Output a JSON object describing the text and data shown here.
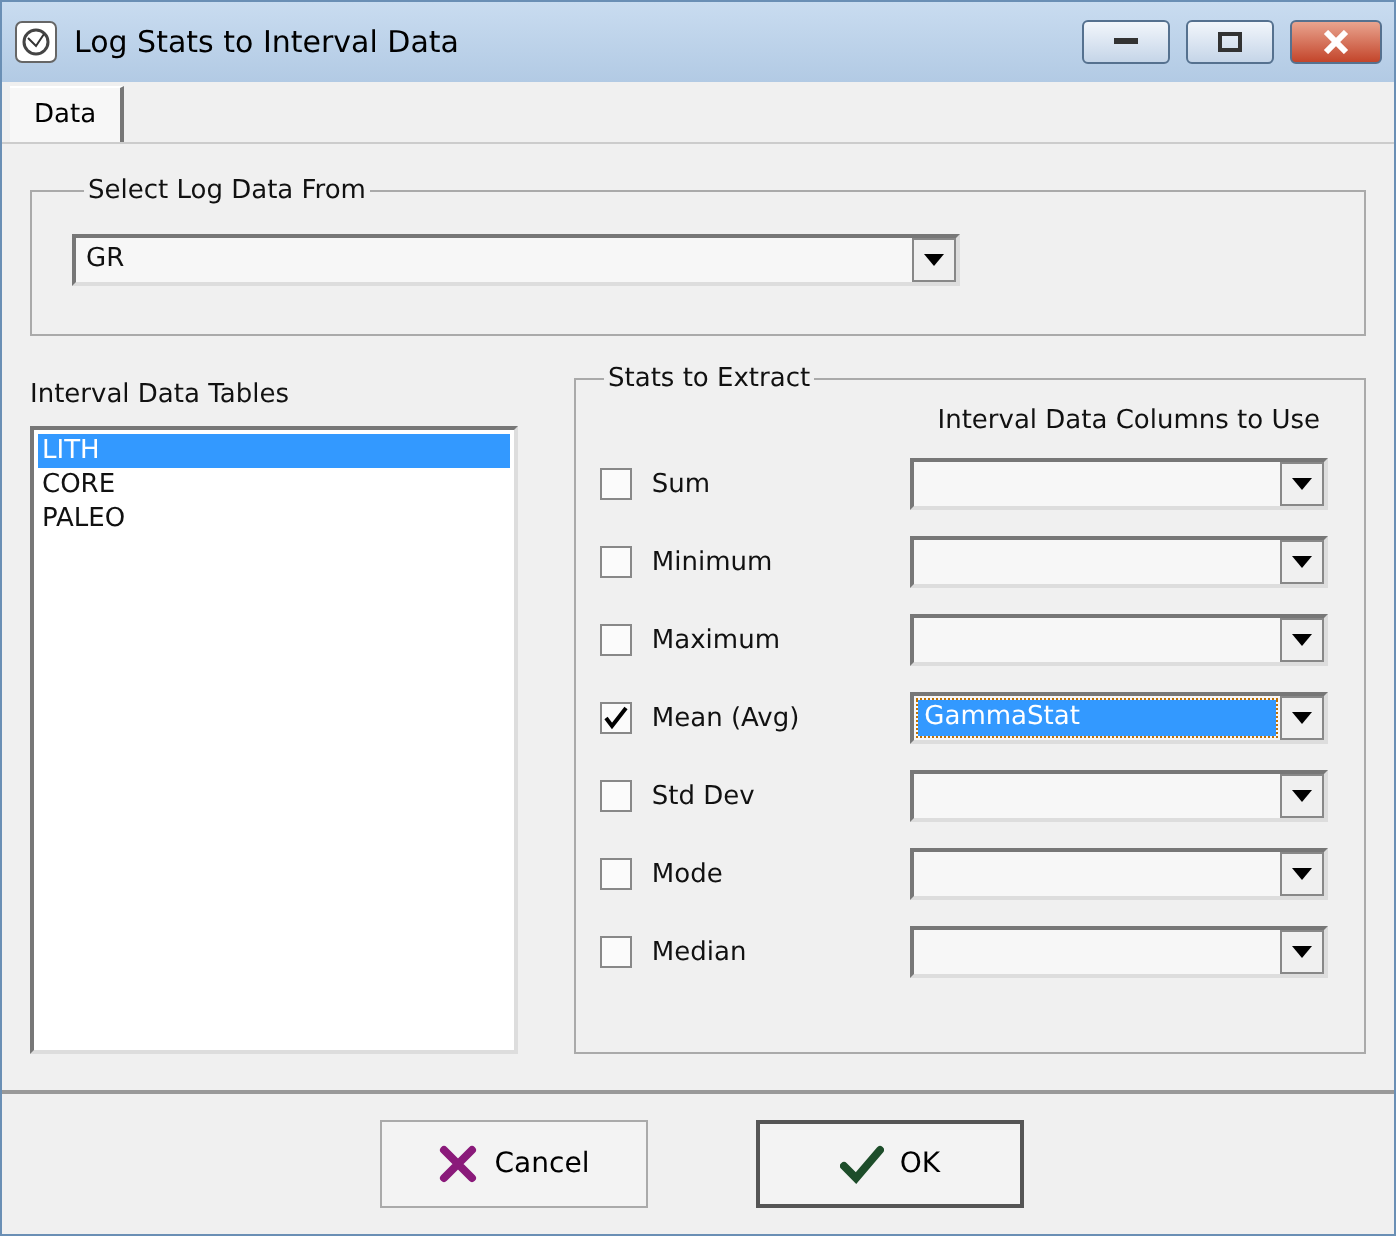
{
  "window": {
    "title": "Log Stats to Interval Data"
  },
  "tabs": [
    {
      "label": "Data",
      "selected": true
    }
  ],
  "log_source": {
    "label": "Select Log Data From",
    "value": "GR"
  },
  "interval_tables": {
    "label": "Interval Data Tables",
    "items": [
      {
        "label": "LITH",
        "selected": true
      },
      {
        "label": "CORE",
        "selected": false
      },
      {
        "label": "PALEO",
        "selected": false
      }
    ]
  },
  "stats": {
    "label": "Stats to Extract",
    "column_header": "Interval Data Columns to Use",
    "rows": [
      {
        "label": "Sum",
        "checked": false,
        "column": "",
        "selected": false
      },
      {
        "label": "Minimum",
        "checked": false,
        "column": "",
        "selected": false
      },
      {
        "label": "Maximum",
        "checked": false,
        "column": "",
        "selected": false
      },
      {
        "label": "Mean (Avg)",
        "checked": true,
        "column": "GammaStat",
        "selected": true
      },
      {
        "label": "Std Dev",
        "checked": false,
        "column": "",
        "selected": false
      },
      {
        "label": "Mode",
        "checked": false,
        "column": "",
        "selected": false
      },
      {
        "label": "Median",
        "checked": false,
        "column": "",
        "selected": false
      }
    ]
  },
  "buttons": [
    {
      "label": "Cancel",
      "kind": "cancel",
      "default": false
    },
    {
      "label": "OK",
      "kind": "ok",
      "default": true
    }
  ]
}
